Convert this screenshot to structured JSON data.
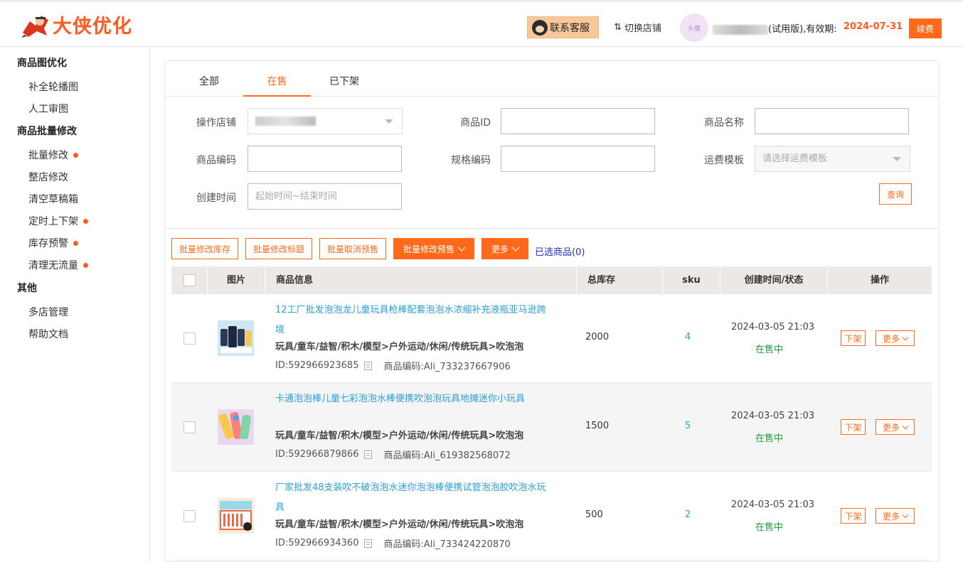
{
  "header": {
    "logo_text": "大侠优化",
    "service_label": "联系客服",
    "switch_shop_label": "切换店铺",
    "switch_icon": "⇅",
    "avatar_text": "头像",
    "user_suffix": "(试用版),有效期:",
    "expiry_date": "2024-07-31",
    "renew_label": "续费"
  },
  "sidebar": {
    "groups": [
      {
        "label": "商品图优化"
      },
      {
        "label": "商品批量修改"
      },
      {
        "label": "其他"
      }
    ],
    "items": [
      {
        "label": "补全轮播图"
      },
      {
        "label": "人工审图"
      },
      {
        "label": "批量修改"
      },
      {
        "label": "整店修改"
      },
      {
        "label": "清空草稿箱"
      },
      {
        "label": "定时上下架"
      },
      {
        "label": "库存预警"
      },
      {
        "label": "清理无流量"
      },
      {
        "label": "多店管理"
      },
      {
        "label": "帮助文档"
      }
    ]
  },
  "tabs": [
    {
      "label": "全部"
    },
    {
      "label": "在售"
    },
    {
      "label": "已下架"
    }
  ],
  "filters": {
    "shop_label": "操作店铺",
    "product_id_label": "商品ID",
    "product_name_label": "商品名称",
    "product_code_label": "商品编码",
    "spec_code_label": "规格编码",
    "freight_label": "运费模板",
    "freight_placeholder": "请选择运费模板",
    "created_label": "创建时间",
    "created_placeholder": "起始时间~结束时间",
    "query_label": "查询"
  },
  "actions": {
    "batch_stock": "批量修改库存",
    "batch_title": "批量修改标题",
    "batch_cancel_presale": "批量取消预售",
    "batch_presale": "批量修改预售",
    "more": "更多",
    "selected": "已选商品(0)"
  },
  "table": {
    "headers": {
      "image": "图片",
      "info": "商品信息",
      "stock": "总库存",
      "sku": "sku",
      "created": "创建时间/状态",
      "ops": "操作"
    },
    "rows": [
      {
        "title": "12工厂批发泡泡龙儿童玩具枪棒配套泡泡水浓缩补充液瓶亚马逊跨境",
        "category": "玩具/童车/益智/积木/模型>户外运动/休闲/传统玩具>吹泡泡",
        "id_text": "ID:592966923685",
        "code_text": "商品编码:Ali_733237667906",
        "stock": "2000",
        "sku": "4",
        "created": "2024-03-05 21:03",
        "status": "在售中",
        "op_down": "下架",
        "op_more": "更多"
      },
      {
        "title": "卡通泡泡棒儿童七彩泡泡水棒便携吹泡泡玩具地摊迷你小玩具",
        "category": "玩具/童车/益智/积木/模型>户外运动/休闲/传统玩具>吹泡泡",
        "id_text": "ID:592966879866",
        "code_text": "商品编码:Ali_619382568072",
        "stock": "1500",
        "sku": "5",
        "created": "2024-03-05 21:03",
        "status": "在售中",
        "op_down": "下架",
        "op_more": "更多"
      },
      {
        "title": "厂家批发48支装吹不破泡泡水迷你泡泡棒便携试管泡泡胶吹泡水玩具",
        "category": "玩具/童车/益智/积木/模型>户外运动/休闲/传统玩具>吹泡泡",
        "id_text": "ID:592966934360",
        "code_text": "商品编码:Ali_733424220870",
        "stock": "500",
        "sku": "2",
        "created": "2024-03-05 21:03",
        "status": "在售中",
        "op_down": "下架",
        "op_more": "更多"
      }
    ]
  },
  "colors": {
    "accent": "#ff6a1a",
    "link": "#2a9fd6",
    "status_green": "#19a03a"
  }
}
